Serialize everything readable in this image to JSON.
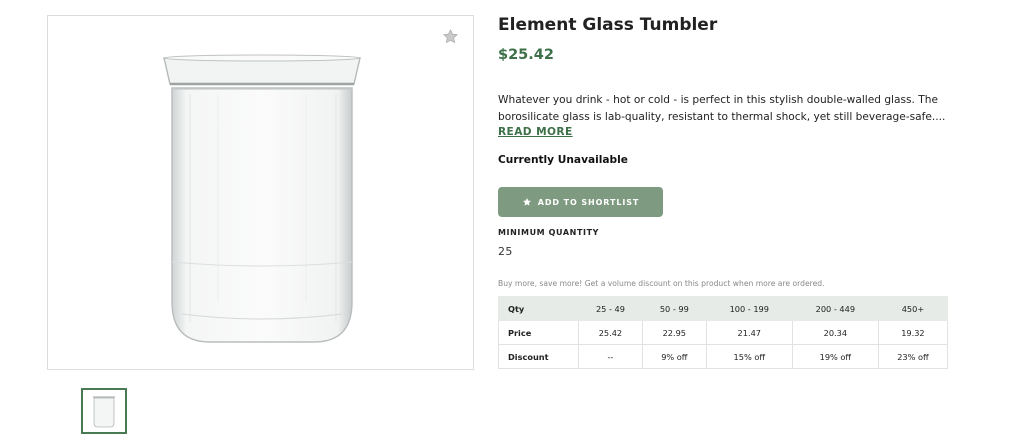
{
  "product": {
    "title": "Element Glass Tumbler",
    "price": "$25.42",
    "description": "Whatever you drink - hot or cold - is perfect in this stylish double-walled glass. The borosilicate glass is lab-quality, resistant to thermal shock, yet still beverage-safe....",
    "read_more": "READ MORE",
    "availability": "Currently Unavailable",
    "shortlist_button": "ADD TO SHORTLIST",
    "min_qty_label": "MINIMUM QUANTITY",
    "min_qty_value": "25",
    "volume_note": "Buy more, save more! Get a volume discount on this product when more are ordered."
  },
  "pricing_table": {
    "rows": [
      [
        "Qty",
        "25 - 49",
        "50 - 99",
        "100 - 199",
        "200 - 449",
        "450+"
      ],
      [
        "Price",
        "25.42",
        "22.95",
        "21.47",
        "20.34",
        "19.32"
      ],
      [
        "Discount",
        "--",
        "9% off",
        "15% off",
        "19% off",
        "23% off"
      ]
    ]
  },
  "icons": {
    "favorite": "star-icon",
    "shortlist": "star-icon"
  },
  "colors": {
    "accent": "#3d7049",
    "button": "#7e9a81",
    "table_header": "#e6ebe7"
  }
}
